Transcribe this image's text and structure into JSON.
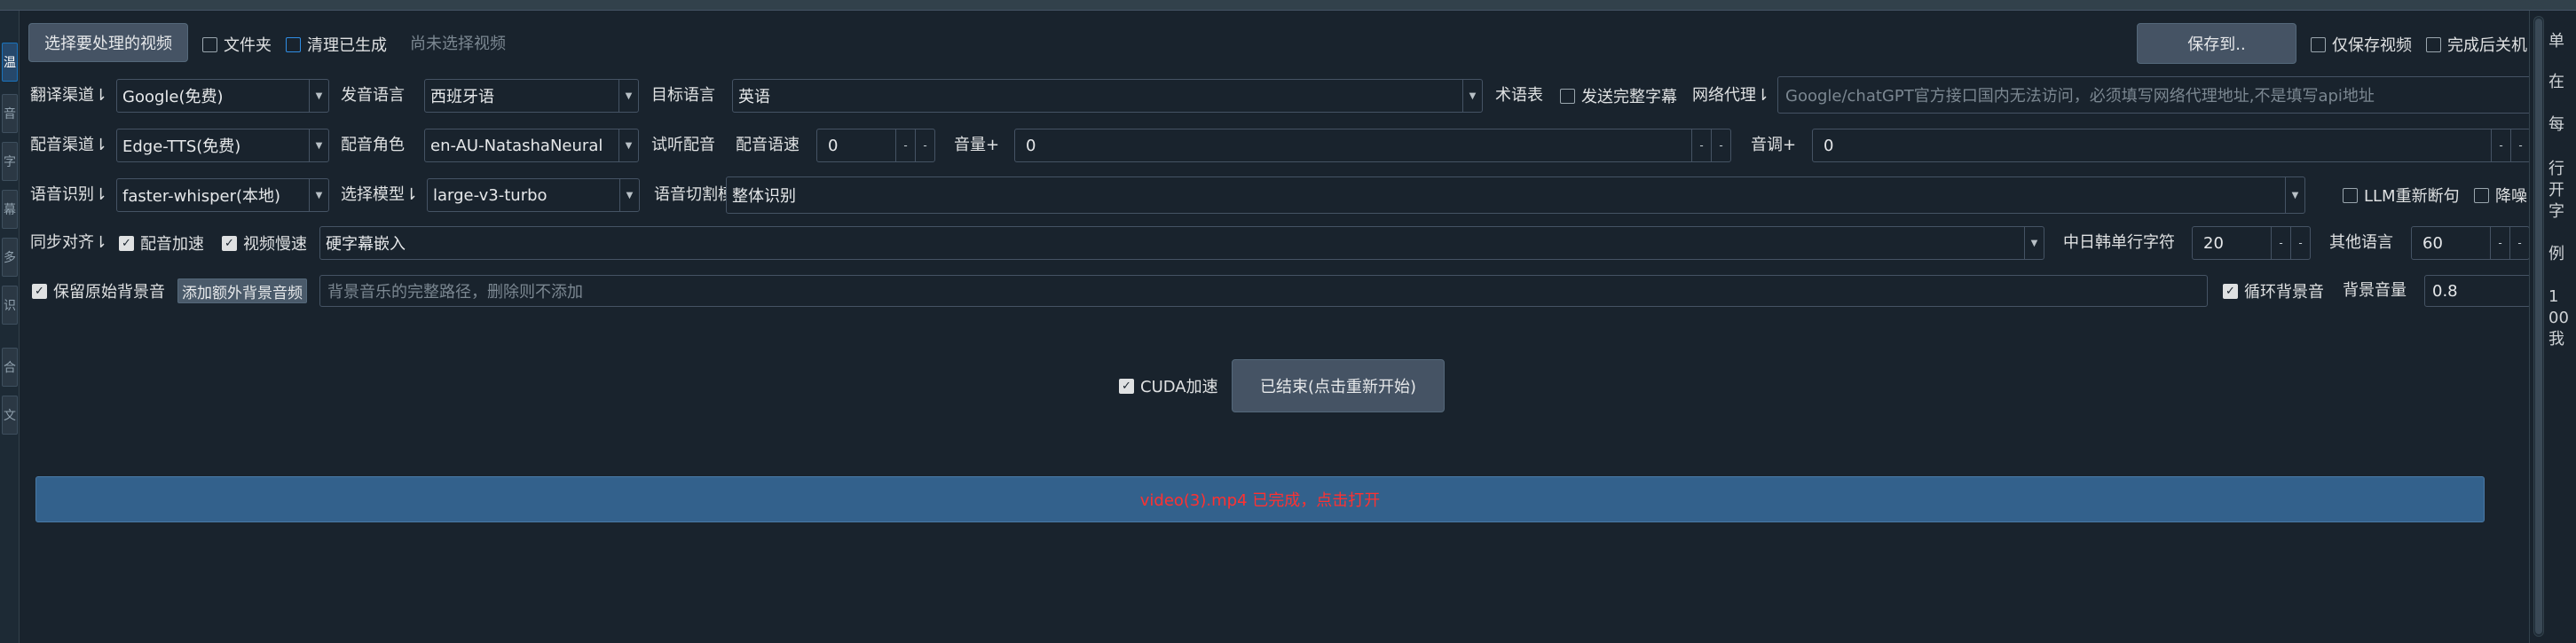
{
  "left_tabs": [
    "温",
    "音",
    "字",
    "幕",
    "多",
    "识",
    "合",
    "文"
  ],
  "row1": {
    "select_video_btn": "选择要处理的视频",
    "folder_chk": "文件夹",
    "clear_generated_chk": "清理已生成",
    "no_video_hint": "尚未选择视频",
    "save_to_btn": "保存到..",
    "only_save_video_chk": "仅保存视频",
    "shutdown_chk": "完成后关机"
  },
  "row2": {
    "translate_channel_label": "翻译渠道⇂",
    "translate_channel_value": "Google(免费)",
    "source_lang_label": "发音语言",
    "source_lang_value": "西班牙语",
    "target_lang_label": "目标语言",
    "target_lang_value": "英语",
    "glossary_label": "术语表",
    "send_full_subs_chk": "发送完整字幕",
    "proxy_label": "网络代理⇂",
    "proxy_placeholder": "Google/chatGPT官方接口国内无法访问，必须填写网络代理地址,不是填写api地址"
  },
  "row3": {
    "dubbing_channel_label": "配音渠道⇂",
    "dubbing_channel_value": "Edge-TTS(免费)",
    "voice_role_label": "配音角色",
    "voice_role_value": "en-AU-NatashaNeural",
    "listen_label": "试听配音",
    "speed_label": "配音语速",
    "speed_value": "0",
    "volume_label": "音量+",
    "volume_value": "0",
    "pitch_label": "音调+",
    "pitch_value": "0"
  },
  "row4": {
    "asr_label": "语音识别⇂",
    "asr_value": "faster-whisper(本地)",
    "model_label": "选择模型⇂",
    "model_value": "large-v3-turbo",
    "split_mode_label": "语音切割模式⇂",
    "split_mode_value": "整体识别",
    "llm_resegment_chk": "LLM重新断句",
    "denoise_chk": "降噪"
  },
  "row5": {
    "sync_label": "同步对齐⇂",
    "dub_speedup_chk": "配音加速",
    "video_slow_chk": "视频慢速",
    "subtitle_mode_value": "硬字幕嵌入",
    "cjk_chars_label": "中日韩单行字符",
    "cjk_chars_value": "20",
    "other_lang_label": "其他语言",
    "other_lang_value": "60"
  },
  "row6": {
    "keep_bgm_chk": "保留原始背景音",
    "add_bgm_btn": "添加额外背景音频",
    "bgm_placeholder": "背景音乐的完整路径，删除则不添加",
    "loop_bgm_chk": "循环背景音",
    "bgm_volume_label": "背景音量",
    "bgm_volume_value": "0.8"
  },
  "action": {
    "cuda_chk": "CUDA加速",
    "restart_btn": "已结束(点击重新开始)"
  },
  "progress": {
    "status_text": "video(3).mp4  已完成，点击打开"
  },
  "right_panel": [
    "单",
    "在",
    "每",
    "行",
    "开",
    "字",
    "例",
    "1",
    "00",
    "我"
  ],
  "colors": {
    "background": "#19232d",
    "button": "#455364",
    "progress_bar": "#33618c",
    "status_text": "#ff3131"
  }
}
